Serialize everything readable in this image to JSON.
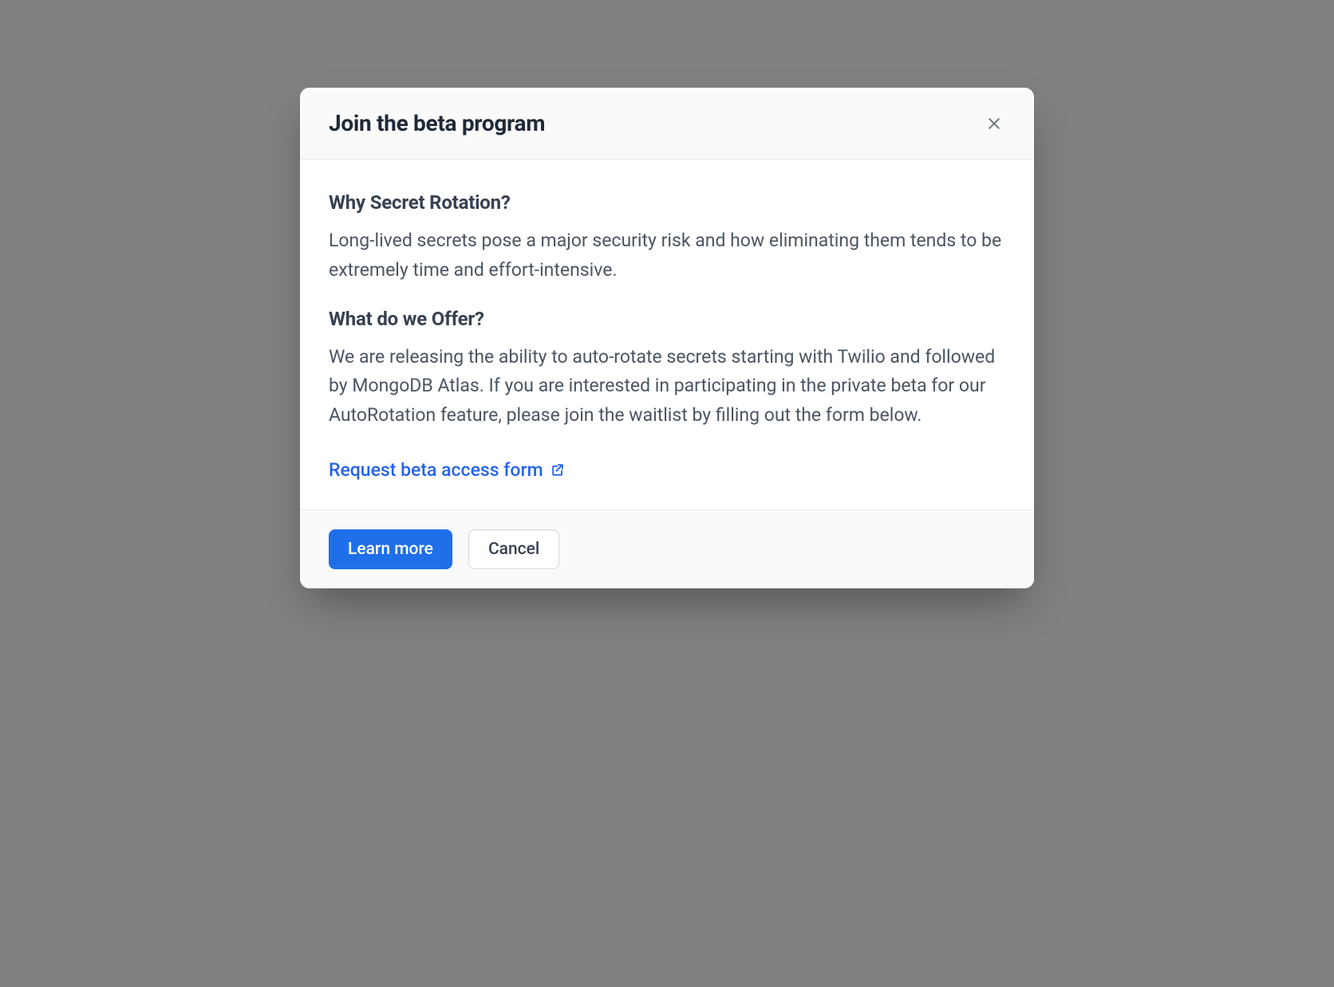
{
  "modal": {
    "title": "Join the beta program",
    "body": {
      "heading1": "Why Secret Rotation?",
      "paragraph1": "Long-lived secrets pose a major security risk and how eliminating them tends to be extremely time and effort-intensive.",
      "heading2": "What do we Offer?",
      "paragraph2": "We are releasing the ability to auto-rotate secrets starting with Twilio and followed by MongoDB Atlas. If you are interested in participating in the private beta for our AutoRotation feature, please join the waitlist by filling out the form below.",
      "link_label": "Request beta access form"
    },
    "footer": {
      "primary_label": "Learn more",
      "secondary_label": "Cancel"
    }
  }
}
